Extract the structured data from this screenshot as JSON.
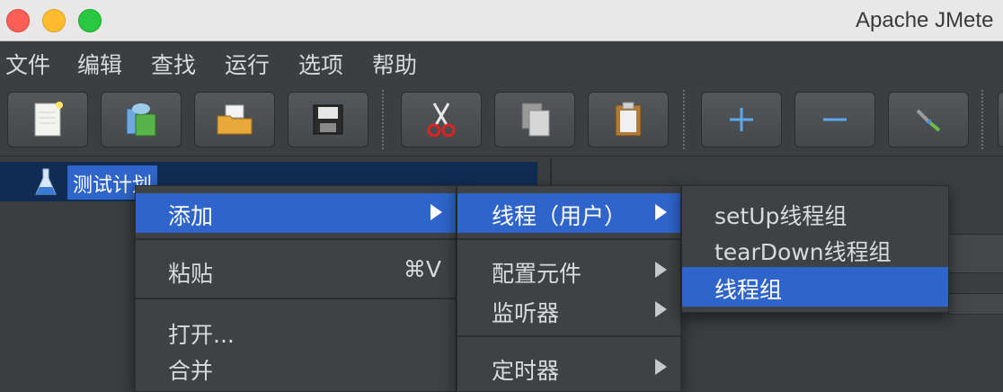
{
  "window": {
    "title": "Apache JMete"
  },
  "menubar": {
    "items": [
      "文件",
      "编辑",
      "查找",
      "运行",
      "选项",
      "帮助"
    ]
  },
  "toolbar": {
    "buttons": [
      "new-icon",
      "templates-icon",
      "open-icon",
      "save-icon",
      "cut-icon",
      "copy-icon",
      "paste-icon",
      "expand-icon",
      "collapse-icon",
      "toggle-icon"
    ]
  },
  "tree": {
    "root_label": "测试计划"
  },
  "context_menu": {
    "add": "添加",
    "paste": "粘贴",
    "paste_shortcut": "⌘V",
    "open": "打开...",
    "merge": "合并"
  },
  "add_submenu": {
    "threads": "线程（用户）",
    "config": "配置元件",
    "listener": "监听器",
    "timer": "定时器"
  },
  "threads_submenu": {
    "setup": "setUp线程组",
    "teardown": "tearDown线程组",
    "thread_group": "线程组"
  },
  "colors": {
    "selection": "#2f65ca",
    "background": "#3c3f41"
  }
}
